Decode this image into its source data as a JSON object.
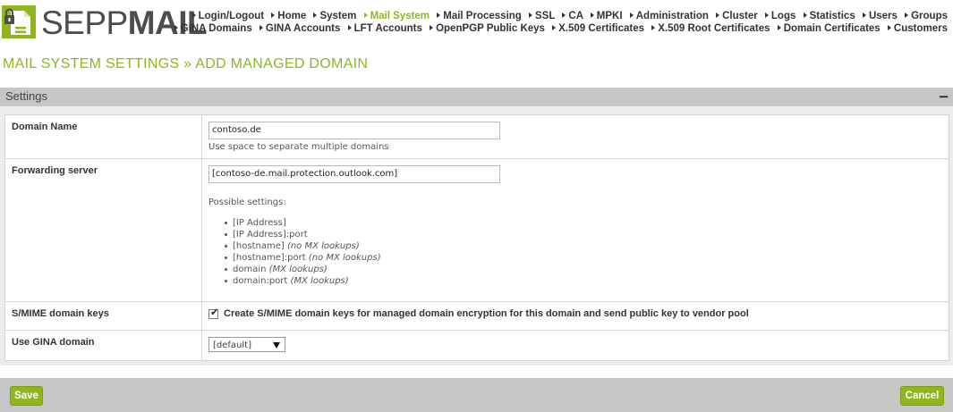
{
  "brand": {
    "logo_light": "SEPP",
    "logo_bold": "MAIL",
    "accent_color": "#8fb61f",
    "logo_icon": "lock-document-icon"
  },
  "nav": {
    "row1": [
      {
        "label": "Login/Logout"
      },
      {
        "label": "Home"
      },
      {
        "label": "System"
      },
      {
        "label": "Mail System",
        "active": true
      },
      {
        "label": "Mail Processing"
      },
      {
        "label": "SSL"
      },
      {
        "label": "CA"
      },
      {
        "label": "MPKI"
      },
      {
        "label": "Administration"
      },
      {
        "label": "Cluster"
      },
      {
        "label": "Logs"
      },
      {
        "label": "Statistics"
      },
      {
        "label": "Users"
      },
      {
        "label": "Groups"
      }
    ],
    "row2": [
      {
        "label": "GINA Domains"
      },
      {
        "label": "GINA Accounts"
      },
      {
        "label": "LFT Accounts"
      },
      {
        "label": "OpenPGP Public Keys"
      },
      {
        "label": "X.509 Certificates"
      },
      {
        "label": "X.509 Root Certificates"
      },
      {
        "label": "Domain Certificates"
      },
      {
        "label": "Customers"
      }
    ]
  },
  "page": {
    "title": "MAIL SYSTEM SETTINGS » ADD MANAGED DOMAIN"
  },
  "settings": {
    "header": "Settings",
    "collapse_symbol": "−",
    "domain_name": {
      "label": "Domain Name",
      "value": "contoso.de",
      "hint": "Use space to separate multiple domains"
    },
    "forwarding": {
      "label": "Forwarding server",
      "value": "[contoso-de.mail.protection.outlook.com]",
      "possible_title": "Possible settings:",
      "options": [
        {
          "text": "[IP Address]",
          "note": ""
        },
        {
          "text": "[IP Address]:port",
          "note": ""
        },
        {
          "text": "[hostname] ",
          "note": "(no MX lookups)"
        },
        {
          "text": "[hostname]:port ",
          "note": "(no MX lookups)"
        },
        {
          "text": "domain ",
          "note": "(MX lookups)"
        },
        {
          "text": "domain:port ",
          "note": "(MX lookups)"
        }
      ]
    },
    "smime": {
      "label": "S/MIME domain keys",
      "checked": true,
      "checkbox_label": "Create S/MIME domain keys for managed domain encryption for this domain and send public key to vendor pool"
    },
    "gina": {
      "label": "Use GINA domain",
      "selected": "[default]"
    }
  },
  "footer": {
    "save_label": "Save",
    "cancel_label": "Cancel"
  }
}
